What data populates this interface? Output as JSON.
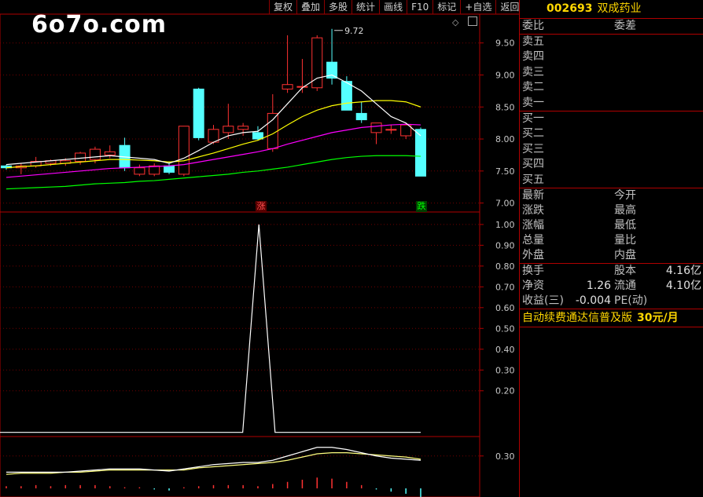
{
  "watermark": "6o7o.com",
  "toolbar": [
    "复权",
    "叠加",
    "多股",
    "统计",
    "画线",
    "F10",
    "标记",
    "+自选",
    "返回"
  ],
  "stock": {
    "code": "002693",
    "name": "双成药业"
  },
  "orderbook": {
    "ratio_label": "委比",
    "diff_label": "委差",
    "sell": [
      "卖五",
      "卖四",
      "卖三",
      "卖二",
      "卖一"
    ],
    "buy": [
      "买一",
      "买二",
      "买三",
      "买四",
      "买五"
    ]
  },
  "quote": [
    [
      "最新",
      "今开"
    ],
    [
      "涨跌",
      "最高"
    ],
    [
      "涨幅",
      "最低"
    ],
    [
      "总量",
      "量比"
    ],
    [
      "外盘",
      "内盘"
    ]
  ],
  "fundamentals": [
    {
      "l": "换手",
      "v1": "",
      "m": "股本",
      "v2": "4.16亿"
    },
    {
      "l": "净资",
      "v1": "1.26",
      "m": "流通",
      "v2": "4.10亿"
    },
    {
      "l": "收益(三)",
      "v1": "-0.004",
      "m": "PE(动)",
      "v2": ""
    }
  ],
  "promo": {
    "text": "自动续费通达信普及版",
    "price": "30元/月"
  },
  "tags": {
    "up": "涨",
    "down": "跌"
  },
  "colors": {
    "up": "#ff3232",
    "down": "#54ffff",
    "border": "#b00000",
    "ma5": "#ffffff",
    "ma10": "#ffff00",
    "ma20": "#ff00ff",
    "ma60": "#00ff00"
  },
  "chart_data": [
    {
      "type": "candlestick",
      "max_label": "9.72",
      "yticks": [
        "9.50",
        "9.00",
        "8.50",
        "8.00",
        "7.50",
        "7.00"
      ],
      "ylim": [
        6.86,
        9.95
      ],
      "candles": [
        [
          7.58,
          7.6,
          7.52,
          7.55
        ],
        [
          7.55,
          7.62,
          7.45,
          7.58
        ],
        [
          7.58,
          7.72,
          7.55,
          7.65
        ],
        [
          7.62,
          7.68,
          7.58,
          7.66
        ],
        [
          7.62,
          7.7,
          7.58,
          7.66
        ],
        [
          7.65,
          7.8,
          7.6,
          7.78
        ],
        [
          7.68,
          7.88,
          7.62,
          7.84
        ],
        [
          7.75,
          7.9,
          7.7,
          7.8
        ],
        [
          7.9,
          8.02,
          7.5,
          7.55
        ],
        [
          7.45,
          7.6,
          7.42,
          7.55
        ],
        [
          7.45,
          7.62,
          7.42,
          7.58
        ],
        [
          7.58,
          7.65,
          7.45,
          7.48
        ],
        [
          7.45,
          8.2,
          7.42,
          8.2
        ],
        [
          8.78,
          8.8,
          7.98,
          8.02
        ],
        [
          7.95,
          8.22,
          7.92,
          8.15
        ],
        [
          8.1,
          8.55,
          8.0,
          8.2
        ],
        [
          8.15,
          8.25,
          8.05,
          8.2
        ],
        [
          8.1,
          8.2,
          7.98,
          8.0
        ],
        [
          7.85,
          8.7,
          7.8,
          8.4
        ],
        [
          8.78,
          9.62,
          8.72,
          8.85
        ],
        [
          8.82,
          9.25,
          8.72,
          8.82
        ],
        [
          8.8,
          9.62,
          8.75,
          9.58
        ],
        [
          9.2,
          9.72,
          8.85,
          8.95
        ],
        [
          8.9,
          8.98,
          8.45,
          8.45
        ],
        [
          8.4,
          8.58,
          8.25,
          8.3
        ],
        [
          8.1,
          8.25,
          7.92,
          8.25
        ],
        [
          8.15,
          8.22,
          8.08,
          8.15
        ],
        [
          8.05,
          8.25,
          8.0,
          8.22
        ],
        [
          8.15,
          8.18,
          7.42,
          7.42
        ]
      ],
      "ma5": [
        7.6,
        7.62,
        7.64,
        7.66,
        7.68,
        7.7,
        7.72,
        7.74,
        7.72,
        7.7,
        7.68,
        7.62,
        7.7,
        7.82,
        7.95,
        8.05,
        8.1,
        8.12,
        8.3,
        8.55,
        8.8,
        8.95,
        9.0,
        8.88,
        8.75,
        8.55,
        8.35,
        8.25,
        8.05
      ],
      "ma10": [
        7.55,
        7.57,
        7.58,
        7.6,
        7.62,
        7.64,
        7.66,
        7.68,
        7.68,
        7.67,
        7.66,
        7.64,
        7.66,
        7.72,
        7.78,
        7.85,
        7.92,
        7.98,
        8.08,
        8.22,
        8.35,
        8.45,
        8.52,
        8.56,
        8.58,
        8.6,
        8.6,
        8.58,
        8.5
      ],
      "ma20": [
        7.4,
        7.42,
        7.44,
        7.46,
        7.48,
        7.5,
        7.52,
        7.54,
        7.55,
        7.56,
        7.57,
        7.58,
        7.6,
        7.64,
        7.68,
        7.72,
        7.76,
        7.8,
        7.85,
        7.92,
        7.98,
        8.04,
        8.1,
        8.14,
        8.18,
        8.2,
        8.22,
        8.23,
        8.22
      ],
      "ma60": [
        7.22,
        7.23,
        7.24,
        7.25,
        7.26,
        7.28,
        7.3,
        7.31,
        7.32,
        7.34,
        7.35,
        7.37,
        7.39,
        7.41,
        7.43,
        7.45,
        7.48,
        7.5,
        7.53,
        7.56,
        7.6,
        7.64,
        7.68,
        7.71,
        7.73,
        7.74,
        7.74,
        7.74,
        7.73
      ]
    },
    {
      "type": "line",
      "yticks": [
        "1.00",
        "0.90",
        "0.80",
        "0.70",
        "0.60",
        "0.50",
        "0.40",
        "0.30",
        "0.20"
      ],
      "ylim": [
        -0.02,
        1.06
      ],
      "values": [
        0,
        0,
        0,
        0,
        0,
        0,
        0,
        0,
        0,
        0,
        0,
        0,
        0,
        0,
        0,
        0,
        1,
        0,
        0,
        0,
        0,
        0,
        0,
        0,
        0,
        0,
        0
      ]
    },
    {
      "type": "line",
      "yticks": [
        "0.30"
      ],
      "ylim": [
        -0.08,
        0.48
      ],
      "line1": [
        0.15,
        0.15,
        0.15,
        0.15,
        0.15,
        0.16,
        0.17,
        0.18,
        0.18,
        0.18,
        0.17,
        0.16,
        0.18,
        0.2,
        0.22,
        0.23,
        0.24,
        0.24,
        0.26,
        0.3,
        0.34,
        0.38,
        0.38,
        0.36,
        0.33,
        0.3,
        0.28,
        0.27,
        0.26
      ],
      "line2": [
        0.13,
        0.14,
        0.14,
        0.14,
        0.15,
        0.15,
        0.16,
        0.17,
        0.17,
        0.17,
        0.17,
        0.17,
        0.17,
        0.19,
        0.2,
        0.21,
        0.22,
        0.23,
        0.24,
        0.26,
        0.29,
        0.32,
        0.33,
        0.33,
        0.32,
        0.31,
        0.3,
        0.29,
        0.27
      ],
      "bars": [
        0.02,
        0.02,
        0.03,
        0.02,
        0.03,
        0.03,
        0.03,
        0.02,
        0.01,
        0.01,
        -0.01,
        -0.02,
        0.01,
        0.02,
        0.03,
        0.03,
        0.03,
        0.02,
        0.04,
        0.06,
        0.08,
        0.1,
        0.09,
        0.06,
        0.03,
        -0.01,
        -0.03,
        -0.05,
        -0.08
      ]
    }
  ]
}
